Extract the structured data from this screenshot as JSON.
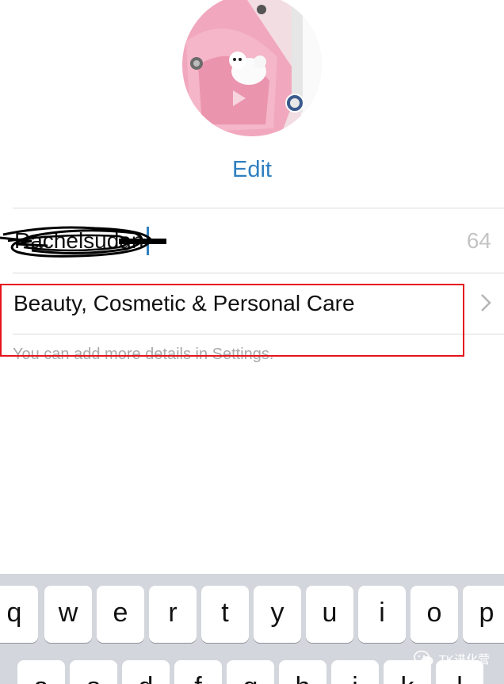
{
  "profile": {
    "edit_label": "Edit",
    "name_value": "Rachelsudan",
    "char_count": "64",
    "category": "Beauty, Cosmetic & Personal Care",
    "helper_text": "You can add more details in Settings."
  },
  "keyboard": {
    "row1": [
      "q",
      "w",
      "e",
      "r",
      "t",
      "y",
      "u",
      "i",
      "o",
      "p"
    ],
    "row2": [
      "a",
      "s",
      "d",
      "f",
      "g",
      "h",
      "j",
      "k",
      "l"
    ]
  },
  "watermark": {
    "text": "TK进化营"
  },
  "colors": {
    "accent": "#2f7fc0",
    "highlight": "#e5141c",
    "keyboard_bg": "#d3d6dc"
  },
  "icons": [
    "avatar-photo",
    "chevron-right-icon",
    "wechat-icon"
  ]
}
